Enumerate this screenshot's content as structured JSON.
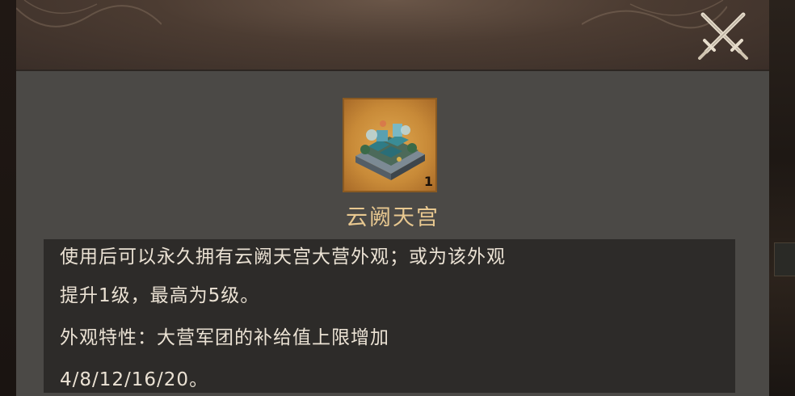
{
  "dialog": {
    "close_icon": "crossed-swords-icon"
  },
  "item": {
    "name": "云阙天宫",
    "count": "1",
    "icon": "palace-camp-icon",
    "icon_bg_color": "#d49a44"
  },
  "description": {
    "lines": [
      "使用后可以永久拥有云阙天宫大营外观；或为该外观",
      "提升1级，最高为5级。",
      "外观特性：大营军团的补给值上限增加",
      "4/8/12/16/20。"
    ]
  },
  "colors": {
    "panel": "#4b4946",
    "desc_box": "#2d2b29",
    "title_text": "#e8c890",
    "body_text": "#ebe2d4"
  }
}
